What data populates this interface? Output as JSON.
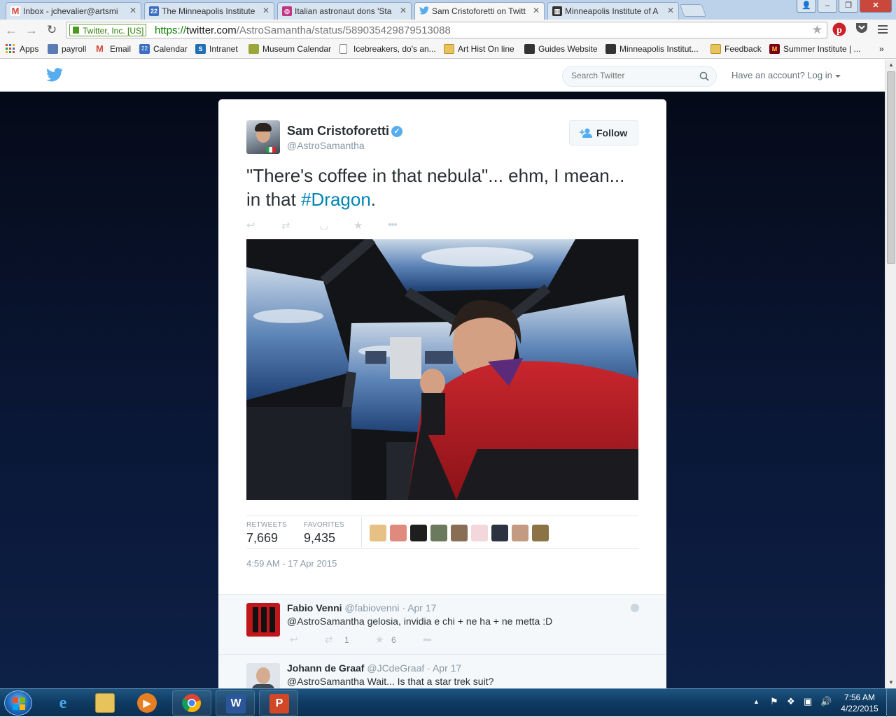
{
  "browser": {
    "tabs": [
      {
        "title": "Inbox - jchevalier@artsmi",
        "icon": "gmail-icon",
        "color": "#d44638"
      },
      {
        "title": "The Minneapolis Institute",
        "icon": "calendar-icon",
        "color": "#3a6fc4"
      },
      {
        "title": "Italian astronaut dons 'Sta",
        "icon": "instagram-icon",
        "color": "#c13584"
      },
      {
        "title": "Sam Cristoforetti on Twitt",
        "icon": "twitter-icon",
        "color": "#55acee"
      },
      {
        "title": "Minneapolis Institute of A",
        "icon": "mia-icon",
        "color": "#333333"
      }
    ],
    "active_tab": 3,
    "security_label": "Twitter, Inc. [US]",
    "url_scheme": "https://",
    "url_host": "twitter.com",
    "url_path": "/AstroSamantha/status/589035429879513088",
    "bookmarks": [
      {
        "label": "Apps",
        "icon": "apps-grid-icon"
      },
      {
        "label": "payroll",
        "icon": "payroll-icon"
      },
      {
        "label": "Email",
        "icon": "gmail-icon"
      },
      {
        "label": "Calendar",
        "icon": "calendar-icon"
      },
      {
        "label": "Intranet",
        "icon": "sharepoint-icon"
      },
      {
        "label": "Museum Calendar",
        "icon": "museum-icon"
      },
      {
        "label": "Icebreakers, do's an...",
        "icon": "page-icon"
      },
      {
        "label": "Art Hist On line",
        "icon": "folder-icon"
      },
      {
        "label": "Guides Website",
        "icon": "mia-icon"
      },
      {
        "label": "Minneapolis Institut...",
        "icon": "mia-icon"
      },
      {
        "label": "Feedback",
        "icon": "folder-icon"
      },
      {
        "label": "Summer Institute | ...",
        "icon": "umn-icon"
      }
    ]
  },
  "twitter_header": {
    "search_placeholder": "Search Twitter",
    "account_prompt": "Have an account?",
    "login_label": "Log in"
  },
  "tweet": {
    "fullname": "Sam Cristoforetti",
    "screen_name": "@AstroSamantha",
    "follow_label": "Follow",
    "text_before": "\"There's coffee in that nebula\"... ehm, I mean... in that ",
    "hashtag": "#Dragon",
    "text_after": ".",
    "retweets_label": "RETWEETS",
    "retweets_count": "7,669",
    "favorites_label": "FAVORITES",
    "favorites_count": "9,435",
    "timestamp": "4:59 AM - 17 Apr 2015"
  },
  "replies": [
    {
      "fullname": "Fabio Venni",
      "screen_name": "@fabiovenni",
      "date": "Apr 17",
      "text": "@AstroSamantha gelosia, invidia e chi + ne ha + ne metta :D",
      "retweets": "1",
      "favorites": "6"
    },
    {
      "fullname": "Johann de Graaf",
      "screen_name": "@JCdeGraaf",
      "date": "Apr 17",
      "text": "@AstroSamantha Wait... Is that a star trek suit?"
    }
  ],
  "taskbar": {
    "time": "7:56 AM",
    "date": "4/22/2015",
    "apps": [
      "internet-explorer-icon",
      "file-explorer-icon",
      "media-player-icon",
      "chrome-icon",
      "word-icon",
      "powerpoint-icon"
    ]
  },
  "colors": {
    "twitter_blue": "#55acee",
    "link_blue": "#0084b4",
    "page_background": "#0a1736"
  }
}
